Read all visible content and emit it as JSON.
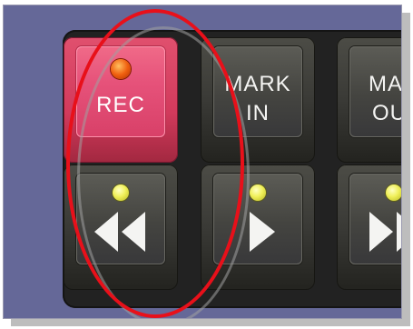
{
  "keys": {
    "rec": {
      "label": "REC",
      "led": "orange",
      "icon": "record-led-icon"
    },
    "mark_in": {
      "line1": "MARK",
      "line2": "IN"
    },
    "mark_out": {
      "line1": "MAR",
      "line2": "OU"
    },
    "rewind": {
      "icon": "rewind-icon",
      "led": "yellow"
    },
    "play": {
      "icon": "play-icon",
      "led": "yellow"
    },
    "fast_forward": {
      "icon": "fast-forward-icon",
      "led": "yellow"
    }
  },
  "annotations": {
    "highlight_color": "#e8101a",
    "secondary_highlight_color": "#a0a0a0"
  },
  "colors": {
    "background_panel": "#656898",
    "key_red": "#e6527a",
    "key_gray": "#444440"
  }
}
